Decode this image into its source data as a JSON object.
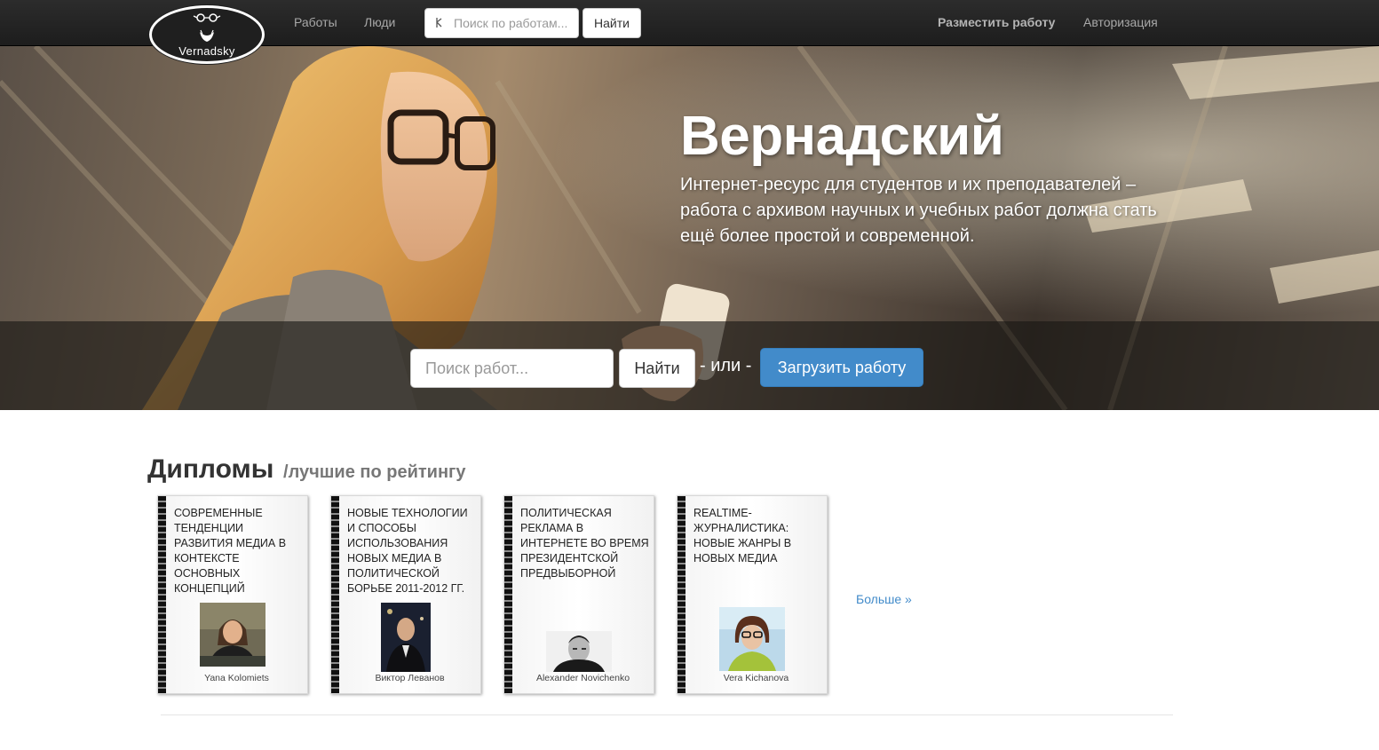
{
  "navbar": {
    "logo_text": "Vernadsky",
    "links": {
      "works": "Работы",
      "people": "Люди"
    },
    "search": {
      "placeholder": "Поиск по работам...",
      "button": "Найти"
    },
    "right": {
      "post_work": "Разместить работу",
      "login": "Авторизация"
    }
  },
  "hero": {
    "title": "Вернадский",
    "description": "Интернет-ресурс для студентов и их преподавателей – работа с архивом научных и учебных работ должна стать ещё более простой и современной.",
    "search_placeholder": "Поиск работ...",
    "find_button": "Найти",
    "or_text": "- или -",
    "upload_button": "Загрузить работу"
  },
  "section": {
    "title": "Дипломы",
    "subtitle": "/лучшие по рейтингу",
    "cards": [
      {
        "title": "Современные тенденции развития медиа в контексте основных концепций",
        "author": "Yana Kolomiets"
      },
      {
        "title": "Новые технологии и способы использования новых медиа в политической борьбе 2011-2012 гг.",
        "author": "Виктор Леванов"
      },
      {
        "title": "Политическая реклама в интернете во время президентской предвыборной",
        "author": "Alexander Novichenko"
      },
      {
        "title": "Realtime-журналистика: новые жанры в новых медиа",
        "author": "Vera Kichanova"
      }
    ],
    "more": "Больше »"
  },
  "colors": {
    "navbar_bg": "#222222",
    "primary": "#428bca",
    "link": "#428bca"
  }
}
